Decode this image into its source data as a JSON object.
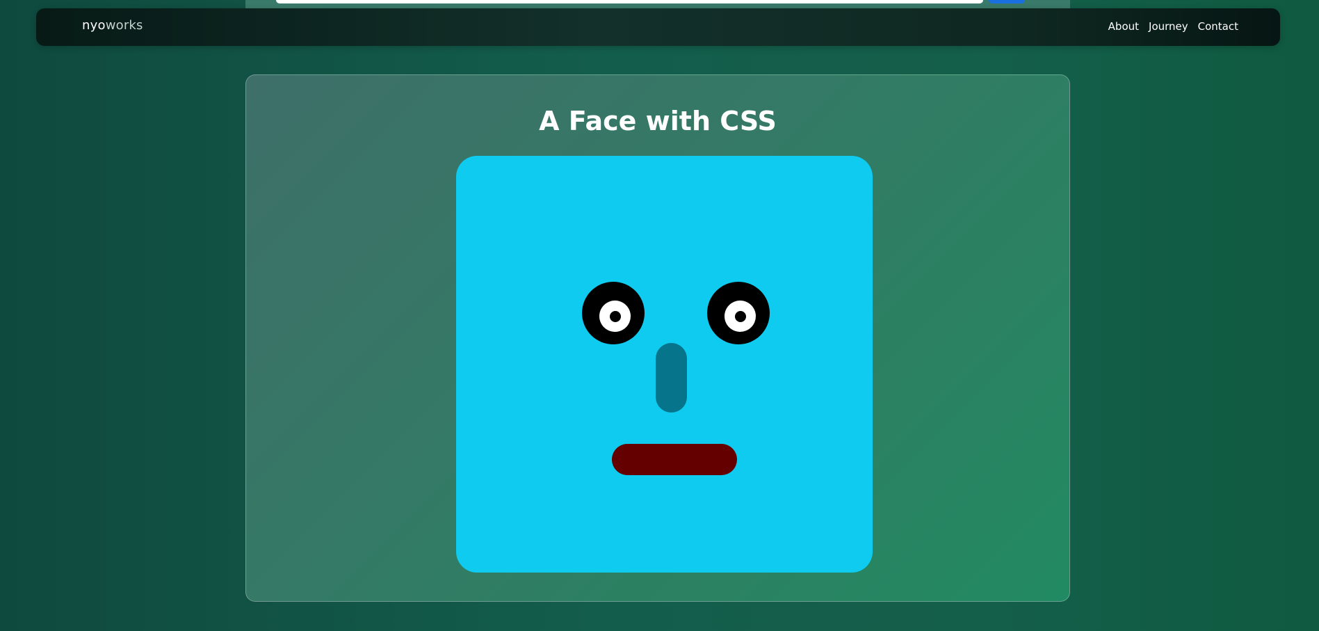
{
  "nav": {
    "brand_primary": "nyo",
    "brand_secondary": "works",
    "links": [
      "About",
      "Journey",
      "Contact"
    ]
  },
  "card": {
    "title": "A Face with CSS"
  },
  "colors": {
    "face": "#0ecbef",
    "nose": "#06758b",
    "mouth": "#650000",
    "eye": "#000000",
    "eye_white": "#ffffff"
  }
}
